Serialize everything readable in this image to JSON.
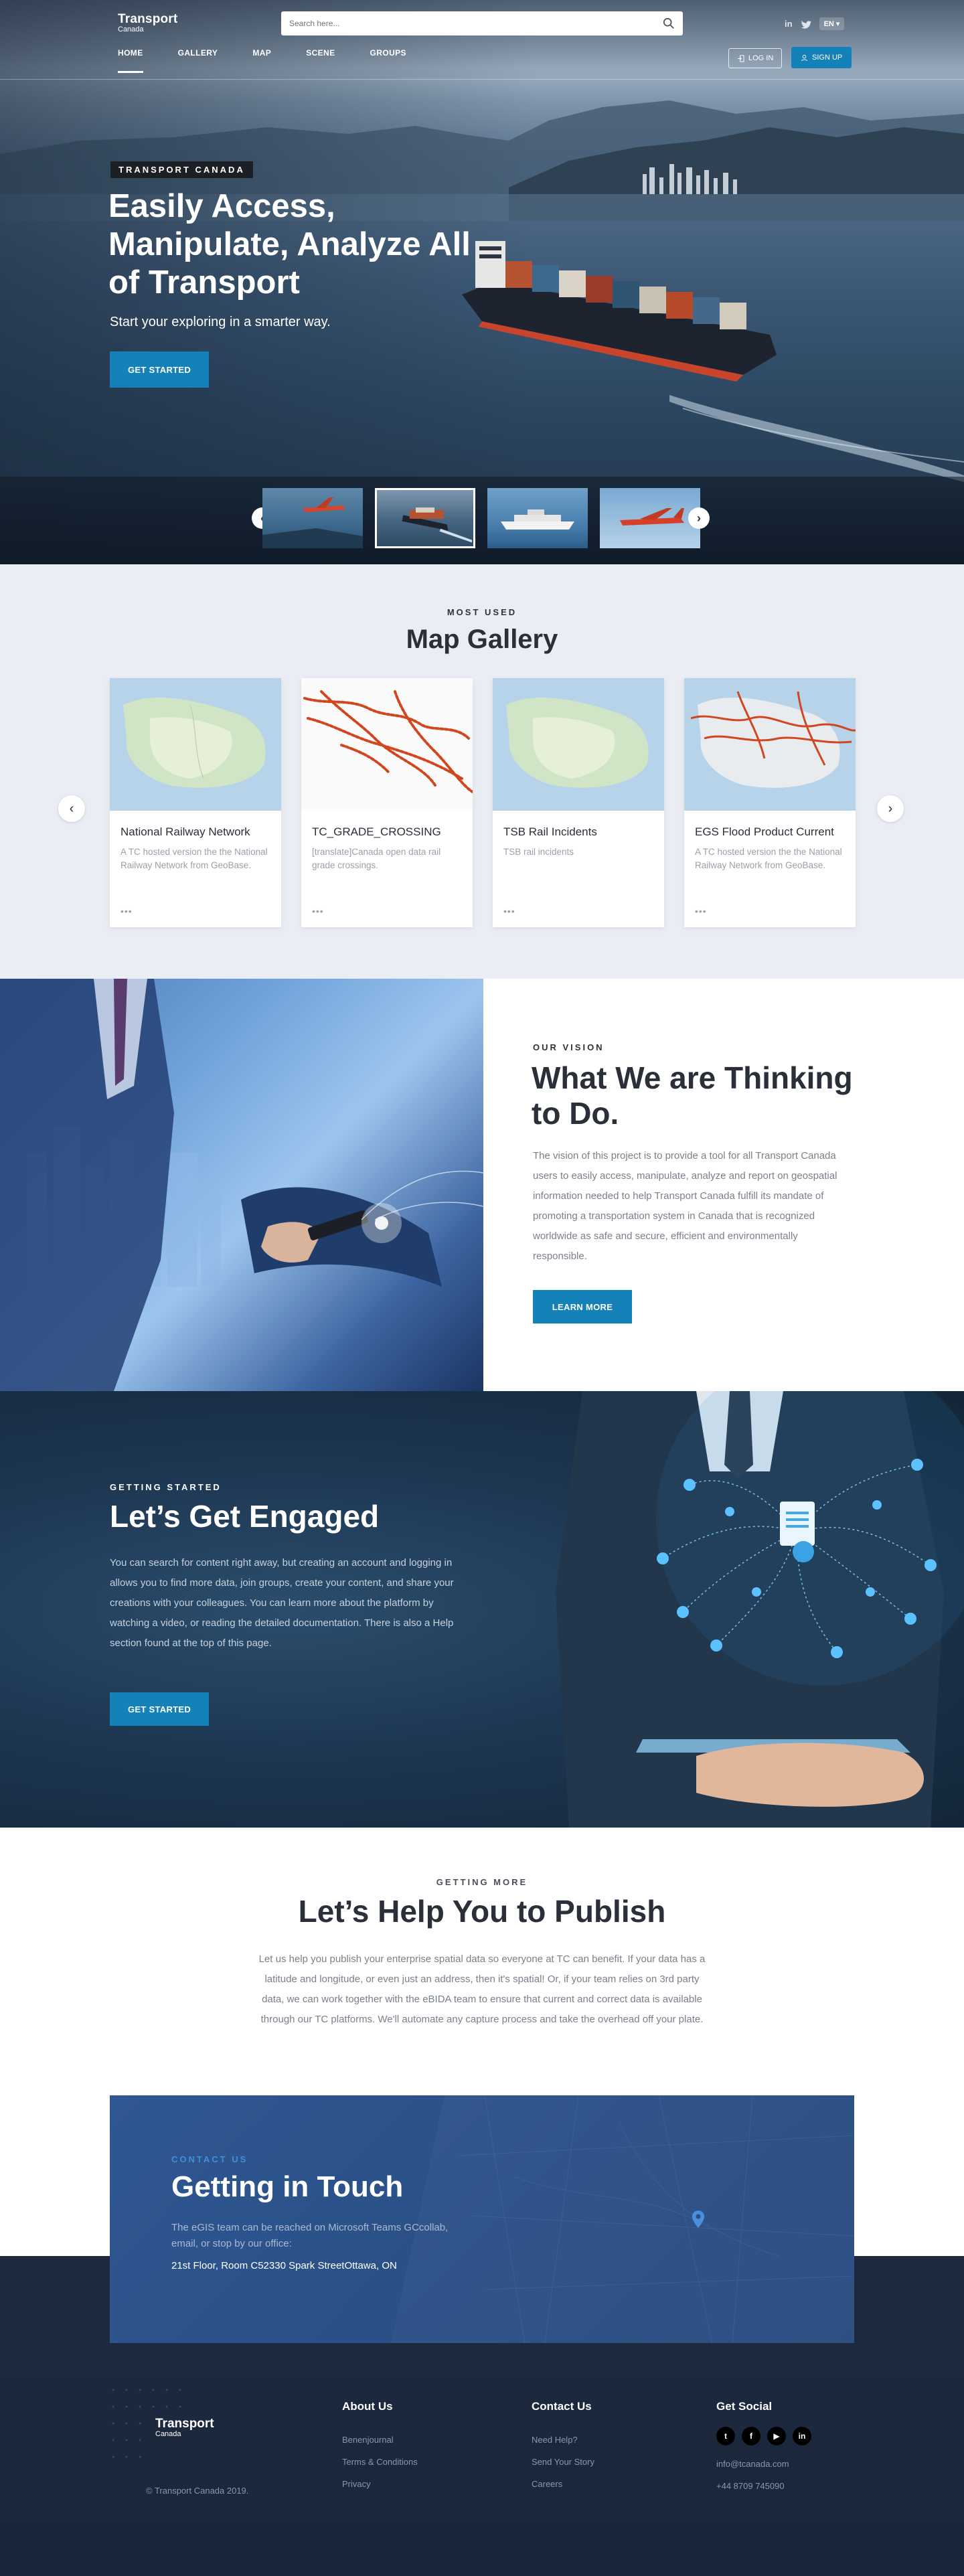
{
  "header": {
    "logo_line1": "Transport",
    "logo_line2": "Canada",
    "search_placeholder": "Search here...",
    "lang": "EN ▾",
    "nav": [
      "HOME",
      "GALLERY",
      "MAP",
      "SCENE",
      "GROUPS"
    ],
    "login": "LOG IN",
    "signup": "SIGN UP"
  },
  "hero": {
    "tag": "TRANSPORT CANADA",
    "title": "Easily Access, Manipulate, Analyze All of Transport",
    "subtitle": "Start your exploring in a smarter way.",
    "cta": "GET STARTED",
    "active_thumb": 2
  },
  "gallery": {
    "eyebrow": "MOST USED",
    "title": "Map Gallery",
    "cards": [
      {
        "title": "National Railway Network",
        "desc": "A TC hosted version the the National Railway Network from GeoBase.",
        "dots": "•••"
      },
      {
        "title": "TC_GRADE_CROSSING",
        "desc": "[translate]Canada open data rail grade crossings.",
        "dots": "•••"
      },
      {
        "title": "TSB Rail Incidents",
        "desc": "TSB rail incidents",
        "dots": "•••"
      },
      {
        "title": "EGS Flood Product Current",
        "desc": "A TC hosted version the the National Railway Network from GeoBase.",
        "dots": "•••"
      }
    ]
  },
  "vision": {
    "eyebrow": "OUR VISION",
    "title": "What We are Thinking to Do.",
    "body": "The vision of this project is to provide a tool for all Transport Canada users to easily access, manipulate, analyze and report on geospatial information needed to help Transport Canada fulfill its mandate of promoting a transportation system in Canada that is recognized worldwide as safe and secure, efficient and environmentally responsible.",
    "cta": "LEARN MORE"
  },
  "engaged": {
    "eyebrow": "GETTING STARTED",
    "title": "Let’s Get Engaged",
    "body": "You can search for content right away, but creating an account and logging in allows you to find more data, join groups, create your content, and share your creations with your colleagues. You can learn more about the platform by watching a video, or reading the detailed documentation. There is also a Help section found at the top of this page.",
    "cta": "GET STARTED"
  },
  "publish": {
    "eyebrow": "GETTING MORE",
    "title": "Let’s Help You to Publish",
    "body": "Let us help you publish your enterprise spatial data so everyone at TC can benefit. If your data has a latitude and longitude, or even just an address, then it's spatial! Or, if your team relies on 3rd party data, we can work together with the eBIDA team to ensure that current and correct data is available through our TC platforms. We'll automate any capture process and take the overhead off your plate."
  },
  "contact": {
    "eyebrow": "CONTACT US",
    "title": "Getting in Touch",
    "body": "The eGIS team can be reached on Microsoft Teams GCcollab, email, or stop by our office:",
    "address": "21st Floor, Room C52330 Spark StreetOttawa, ON"
  },
  "footer": {
    "logo_line1": "Transport",
    "logo_line2": "Canada",
    "copyright": "© Transport Canada 2019.",
    "about_title": "About Us",
    "about_links": [
      "Benenjournal",
      "Terms & Conditions",
      "Privacy"
    ],
    "contact_title": "Contact Us",
    "contact_links": [
      "Need Help?",
      "Send Your Story",
      "Careers"
    ],
    "social_title": "Get Social",
    "social_icons": [
      "twitter-icon",
      "facebook-icon",
      "youtube-icon",
      "linkedin-icon"
    ],
    "email": "info@tcanada.com",
    "phone": "+44 8709 745090"
  },
  "colors": {
    "accent": "#1481b8",
    "gallery_bg": "#ebedf4",
    "engaged_bg": "#1c3550",
    "contact_card": "#2a4f86",
    "footer_bg": "#1d2a40"
  }
}
